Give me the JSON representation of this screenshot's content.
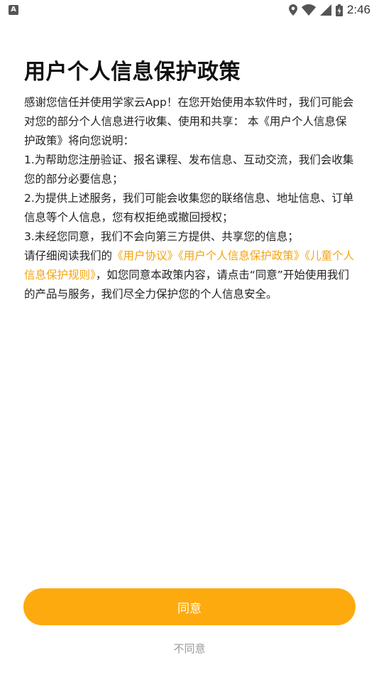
{
  "status_bar": {
    "notification_badge": "A",
    "time": "2:46"
  },
  "policy": {
    "title": "用户个人信息保护政策",
    "intro": "感谢您信任并使用学家云App！在您开始使用本软件时，我们可能会对您的部分个人信息进行收集、使用和共享：  本《用户个人信息保护政策》将向您说明：",
    "item1": " 1.为帮助您注册验证、报名课程、发布信息、互动交流，我们会收集您的部分必要信息；",
    "item2": " 2.为提供上述服务，我们可能会收集您的联络信息、地址信息、订单信息等个人信息，您有权拒绝或撤回授权；",
    "item3": " 3.未经您同意，我们不会向第三方提供、共享您的信息；",
    "closing_prefix": " 请仔细阅读我们的",
    "link_user_agreement": "《用户协议》",
    "link_privacy_policy": "《用户个人信息保护政策》",
    "link_children_rules": "《儿童个人信息保护规则》",
    "closing_suffix": "，如您同意本政策内容，请点击“同意”开始使用我们的产品与服务，我们尽全力保护您的个人信息安全。"
  },
  "buttons": {
    "agree_label": "同意",
    "disagree_label": "不同意"
  },
  "colors": {
    "accent": "#FDAA0F",
    "link": "#F5A30E",
    "muted": "#999999"
  }
}
